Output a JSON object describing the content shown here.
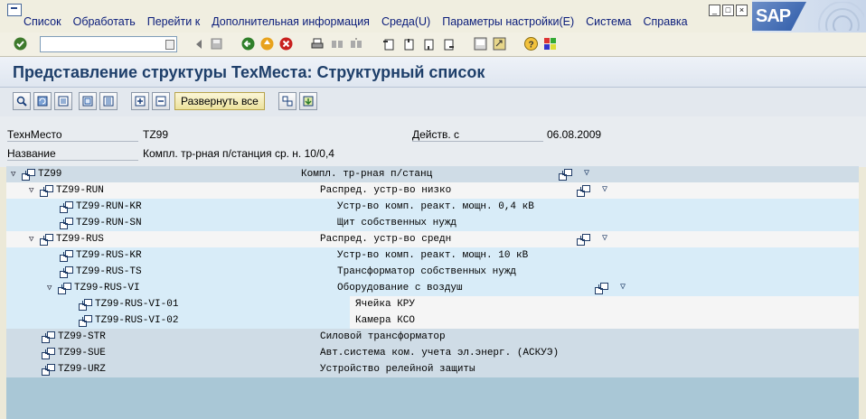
{
  "menu": {
    "items": [
      "Список",
      "Обработать",
      "Перейти к",
      "Дополнительная информация",
      "Среда(U)",
      "Параметры настройки(E)",
      "Система",
      "Справка"
    ]
  },
  "sap_logo_text": "SAP",
  "window_buttons": [
    "_",
    "□",
    "×"
  ],
  "page": {
    "title": "Представление структуры ТехМеста: Структурный список"
  },
  "app_toolbar": {
    "expand_all_label": "Развернуть все"
  },
  "header": {
    "techplace_label": "ТехнМесто",
    "techplace_value": "TZ99",
    "valid_from_label": "Действ. с",
    "valid_from_value": "06.08.2009",
    "name_label": "Название",
    "name_value": "Компл. тр-рная п/станция ср. н. 10/0,4"
  },
  "tree": {
    "rows": [
      {
        "id": "TZ99",
        "desc": "Компл. тр-рная п/станц",
        "level": 0,
        "expanded": true,
        "icons": true
      },
      {
        "id": "TZ99-RUN",
        "desc": "Распред. устр-во низко",
        "level": 1,
        "expanded": true,
        "icons": true
      },
      {
        "id": "TZ99-RUN-KR",
        "desc": "Устр-во комп. реакт. мощн. 0,4 кВ",
        "level": 2,
        "expanded": false,
        "icons": false
      },
      {
        "id": "TZ99-RUN-SN",
        "desc": "Щит собственных нужд",
        "level": 2,
        "expanded": false,
        "icons": false
      },
      {
        "id": "TZ99-RUS",
        "desc": "Распред. устр-во средн",
        "level": 1,
        "expanded": true,
        "icons": true
      },
      {
        "id": "TZ99-RUS-KR",
        "desc": "Устр-во комп. реакт. мощн. 10 кВ",
        "level": 2,
        "expanded": false,
        "icons": false
      },
      {
        "id": "TZ99-RUS-TS",
        "desc": "Трансформатор собственных нужд",
        "level": 2,
        "expanded": false,
        "icons": false
      },
      {
        "id": "TZ99-RUS-VI",
        "desc": "Оборудование с воздуш",
        "level": 2,
        "expanded": true,
        "icons": true
      },
      {
        "id": "TZ99-RUS-VI-01",
        "desc": "Ячейка КРУ",
        "level": 3,
        "expanded": false,
        "icons": false
      },
      {
        "id": "TZ99-RUS-VI-02",
        "desc": "Камера КСО",
        "level": 3,
        "expanded": false,
        "icons": false
      },
      {
        "id": "TZ99-STR",
        "desc": "Силовой трансформатор",
        "level": 1,
        "expanded": false,
        "icons": false
      },
      {
        "id": "TZ99-SUE",
        "desc": "Авт.система ком. учета эл.энерг. (АСКУЭ)",
        "level": 1,
        "expanded": false,
        "icons": false
      },
      {
        "id": "TZ99-URZ",
        "desc": "Устройство релейной защиты",
        "level": 1,
        "expanded": false,
        "icons": false
      }
    ]
  },
  "icons": {
    "toolbar": [
      "enter-icon",
      "command-field",
      "back-icon",
      "save-icon",
      "green-arrow-back-icon",
      "exit-icon",
      "cancel-icon",
      "print-icon",
      "find-icon",
      "find-next-icon",
      "first-page-icon",
      "prev-page-icon",
      "next-page-icon",
      "last-page-icon",
      "new-session-icon",
      "shortcut-icon",
      "help-icon",
      "customize-layout-icon"
    ],
    "app_toolbar": [
      "select-icon",
      "refresh-icon",
      "display-icon",
      "detail-icon",
      "list-icon",
      "expand-icon",
      "collapse-icon",
      "expand-all-button",
      "hierarchy-up-icon",
      "hierarchy-down-icon"
    ]
  }
}
